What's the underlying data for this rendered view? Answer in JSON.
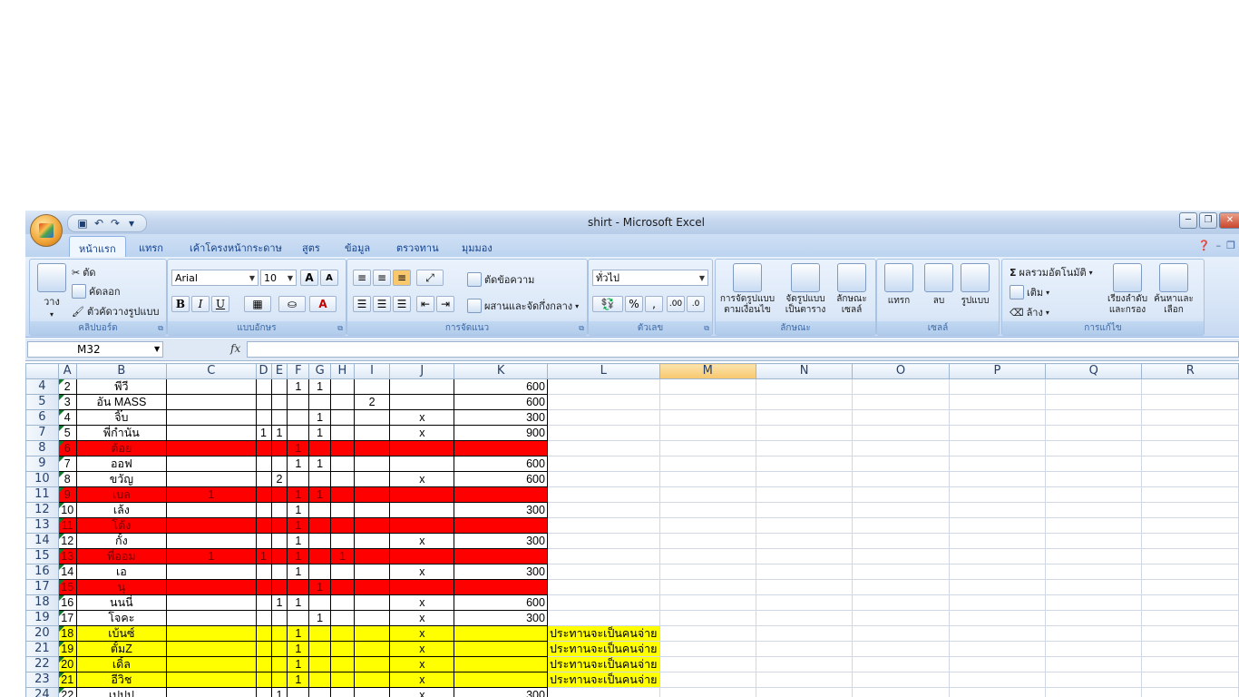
{
  "app": {
    "title": "shirt - Microsoft Excel",
    "qat_icons": [
      "save-icon",
      "undo-icon",
      "redo-icon",
      "customize-icon"
    ]
  },
  "tabs": [
    "หน้าแรก",
    "แทรก",
    "เค้าโครงหน้ากระดาษ",
    "สูตร",
    "ข้อมูล",
    "ตรวจทาน",
    "มุมมอง"
  ],
  "ribbon": {
    "clipboard": {
      "label": "คลิปบอร์ด",
      "paste": "วาง",
      "cut": "ตัด",
      "copy": "คัดลอก",
      "format_painter": "ตัวคัดวางรูปแบบ"
    },
    "font": {
      "label": "แบบอักษร",
      "font_name": "Arial",
      "font_size": "10",
      "bold": "B",
      "italic": "I",
      "underline": "U",
      "font_color": "A",
      "grow": "A",
      "shrink": "A"
    },
    "alignment": {
      "label": "การจัดแนว",
      "wrap": "ตัดข้อความ",
      "merge": "ผสานและจัดกึ่งกลาง"
    },
    "number": {
      "label": "ตัวเลข",
      "format": "ทั่วไป",
      "percent": "%",
      "comma": ",",
      "inc_dec": ".00",
      "dec_dec": ".0"
    },
    "styles": {
      "label": "ลักษณะ",
      "conditional": "การจัดรูปแบบตามเงื่อนไข",
      "as_table": "จัดรูปแบบเป็นตาราง",
      "cell_styles": "ลักษณะเซลล์"
    },
    "cells": {
      "label": "เซลล์",
      "insert": "แทรก",
      "delete": "ลบ",
      "format": "รูปแบบ"
    },
    "editing": {
      "label": "การแก้ไข",
      "autosum": "ผลรวมอัตโนมัติ",
      "fill": "เติม",
      "clear": "ล้าง",
      "sort_filter": "เรียงลำดับและกรอง",
      "find_select": "ค้นหาและเลือก"
    }
  },
  "formula_bar": {
    "name_box": "M32",
    "fx": "fx",
    "formula": ""
  },
  "columns": [
    "A",
    "B",
    "C",
    "D",
    "E",
    "F",
    "G",
    "H",
    "I",
    "J",
    "K",
    "L",
    "M",
    "N",
    "O",
    "P",
    "Q",
    "R"
  ],
  "selected_column": "M",
  "rows": [
    {
      "row": "4",
      "A": "2",
      "B": "พีวี",
      "C": "",
      "D": "",
      "E": "",
      "F": "1",
      "G": "1",
      "H": "",
      "I": "",
      "J": "",
      "K": "600",
      "L": "",
      "style": "normal"
    },
    {
      "row": "5",
      "A": "3",
      "B": "อัน MASS",
      "C": "",
      "D": "",
      "E": "",
      "F": "",
      "G": "",
      "H": "",
      "I": "2",
      "J": "",
      "K": "600",
      "L": "",
      "style": "normal"
    },
    {
      "row": "6",
      "A": "4",
      "B": "จิ๊บ",
      "C": "",
      "D": "",
      "E": "",
      "F": "",
      "G": "1",
      "H": "",
      "I": "",
      "J": "x",
      "K": "300",
      "L": "",
      "style": "normal"
    },
    {
      "row": "7",
      "A": "5",
      "B": "พี่กำนัน",
      "C": "",
      "D": "1",
      "E": "1",
      "F": "",
      "G": "1",
      "H": "",
      "I": "",
      "J": "x",
      "K": "900",
      "L": "",
      "style": "normal"
    },
    {
      "row": "8",
      "A": "6",
      "B": "ต้อย",
      "C": "",
      "D": "",
      "E": "",
      "F": "1",
      "G": "",
      "H": "",
      "I": "",
      "J": "",
      "K": "",
      "L": "",
      "style": "red"
    },
    {
      "row": "9",
      "A": "7",
      "B": "ออฟ",
      "C": "",
      "D": "",
      "E": "",
      "F": "1",
      "G": "1",
      "H": "",
      "I": "",
      "J": "",
      "K": "600",
      "L": "",
      "style": "normal"
    },
    {
      "row": "10",
      "A": "8",
      "B": "ขวัญ",
      "C": "",
      "D": "",
      "E": "2",
      "F": "",
      "G": "",
      "H": "",
      "I": "",
      "J": "x",
      "K": "600",
      "L": "",
      "style": "normal"
    },
    {
      "row": "11",
      "A": "9",
      "B": "เบล",
      "C": "1",
      "D": "",
      "E": "",
      "F": "1",
      "G": "1",
      "H": "",
      "I": "",
      "J": "",
      "K": "",
      "L": "",
      "style": "red"
    },
    {
      "row": "12",
      "A": "10",
      "B": "เล้ง",
      "C": "",
      "D": "",
      "E": "",
      "F": "1",
      "G": "",
      "H": "",
      "I": "",
      "J": "",
      "K": "300",
      "L": "",
      "style": "normal"
    },
    {
      "row": "13",
      "A": "11",
      "B": "โต้ง",
      "C": "",
      "D": "",
      "E": "",
      "F": "1",
      "G": "",
      "H": "",
      "I": "",
      "J": "",
      "K": "",
      "L": "",
      "style": "red"
    },
    {
      "row": "14",
      "A": "12",
      "B": "กั้ง",
      "C": "",
      "D": "",
      "E": "",
      "F": "1",
      "G": "",
      "H": "",
      "I": "",
      "J": "x",
      "K": "300",
      "L": "",
      "style": "normal"
    },
    {
      "row": "15",
      "A": "13",
      "B": "พี่ออม",
      "C": "1",
      "D": "1",
      "E": "",
      "F": "1",
      "G": "",
      "H": "1",
      "I": "",
      "J": "",
      "K": "",
      "L": "",
      "style": "red"
    },
    {
      "row": "16",
      "A": "14",
      "B": "เอ",
      "C": "",
      "D": "",
      "E": "",
      "F": "1",
      "G": "",
      "H": "",
      "I": "",
      "J": "x",
      "K": "300",
      "L": "",
      "style": "normal"
    },
    {
      "row": "17",
      "A": "15",
      "B": "นุ",
      "C": "",
      "D": "",
      "E": "",
      "F": "",
      "G": "1",
      "H": "",
      "I": "",
      "J": "",
      "K": "",
      "L": "",
      "style": "red"
    },
    {
      "row": "18",
      "A": "16",
      "B": "นนนี่",
      "C": "",
      "D": "",
      "E": "1",
      "F": "1",
      "G": "",
      "H": "",
      "I": "",
      "J": "x",
      "K": "600",
      "L": "",
      "style": "normal"
    },
    {
      "row": "19",
      "A": "17",
      "B": "โจคะ",
      "C": "",
      "D": "",
      "E": "",
      "F": "",
      "G": "1",
      "H": "",
      "I": "",
      "J": "x",
      "K": "300",
      "L": "",
      "style": "normal"
    },
    {
      "row": "20",
      "A": "18",
      "B": "เบ้นซ์",
      "C": "",
      "D": "",
      "E": "",
      "F": "1",
      "G": "",
      "H": "",
      "I": "",
      "J": "x",
      "K": "",
      "L": "ประทานจะเป็นคนจ่าย",
      "style": "yellow"
    },
    {
      "row": "21",
      "A": "19",
      "B": "ตั้มZ",
      "C": "",
      "D": "",
      "E": "",
      "F": "1",
      "G": "",
      "H": "",
      "I": "",
      "J": "x",
      "K": "",
      "L": "ประทานจะเป็นคนจ่าย",
      "style": "yellow"
    },
    {
      "row": "22",
      "A": "20",
      "B": "เดิ้ล",
      "C": "",
      "D": "",
      "E": "",
      "F": "1",
      "G": "",
      "H": "",
      "I": "",
      "J": "x",
      "K": "",
      "L": "ประทานจะเป็นคนจ่าย",
      "style": "yellow"
    },
    {
      "row": "23",
      "A": "21",
      "B": "อีวิช",
      "C": "",
      "D": "",
      "E": "",
      "F": "1",
      "G": "",
      "H": "",
      "I": "",
      "J": "x",
      "K": "",
      "L": "ประทานจะเป็นคนจ่าย",
      "style": "yellow"
    },
    {
      "row": "24",
      "A": "22",
      "B": "เปปป",
      "C": "",
      "D": "",
      "E": "1",
      "F": "",
      "G": "",
      "H": "",
      "I": "",
      "J": "x",
      "K": "300",
      "L": "",
      "style": "normal"
    }
  ],
  "colors": {
    "red_fill": "#ff0000",
    "yellow_fill": "#ffff00",
    "selected_header": "#f7c76c"
  }
}
